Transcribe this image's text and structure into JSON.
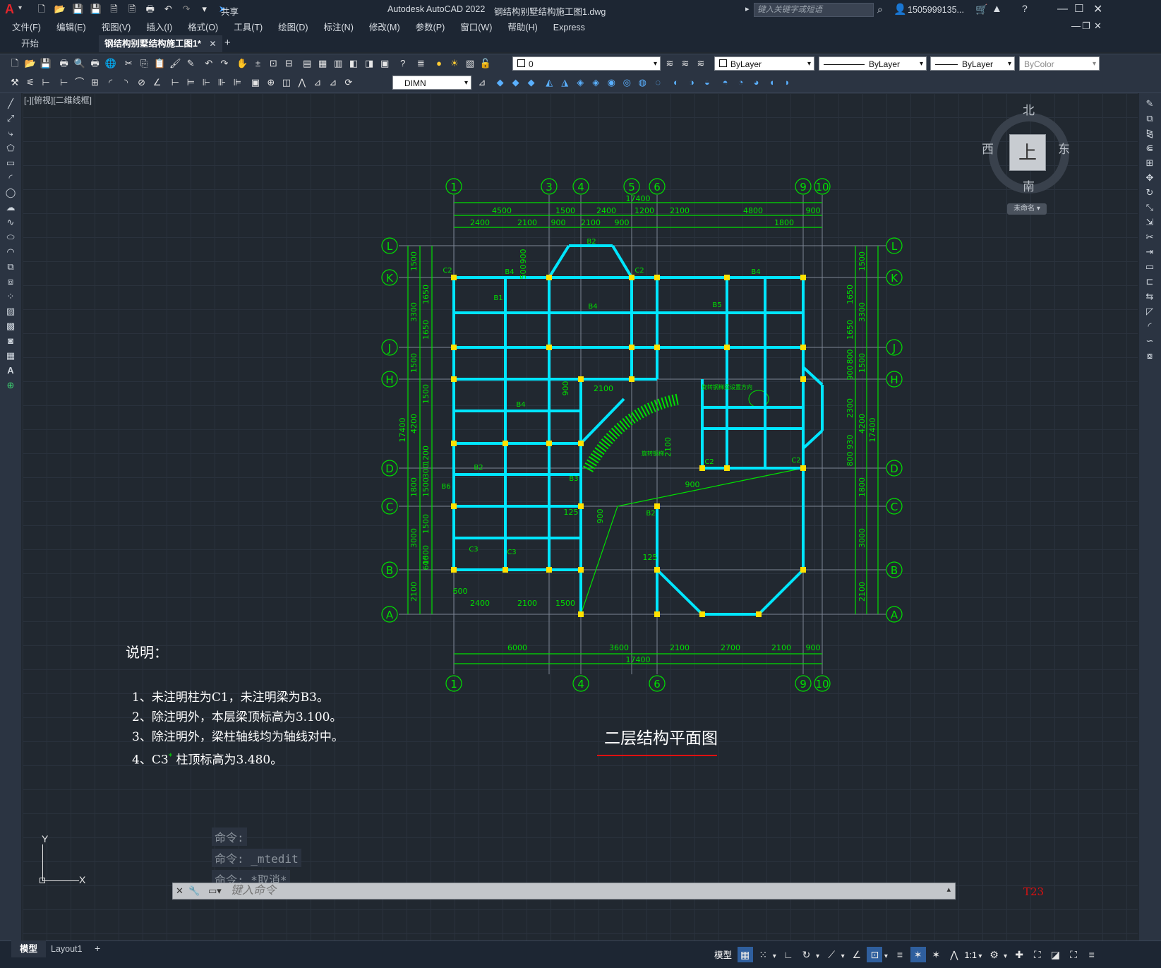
{
  "title_bar": {
    "app_letter": "A",
    "share_label": "共享",
    "app_title": "Autodesk AutoCAD 2022",
    "doc_title": "钢结构别墅结构施工图1.dwg",
    "search_placeholder": "键入关键字或短语",
    "user": "1505999135..."
  },
  "menu": [
    "文件(F)",
    "编辑(E)",
    "视图(V)",
    "插入(I)",
    "格式(O)",
    "工具(T)",
    "绘图(D)",
    "标注(N)",
    "修改(M)",
    "参数(P)",
    "窗口(W)",
    "帮助(H)",
    "Express"
  ],
  "tabs": {
    "start": "开始",
    "doc": "钢结构别墅结构施工图1*",
    "add": "+"
  },
  "toolbar": {
    "layer": "0",
    "color": "ByLayer",
    "linetype": "ByLayer",
    "lineweight": "ByLayer",
    "plotstyle": "ByColor",
    "dimstyle": "DIMN"
  },
  "viewport_label": "[-][俯视][二维线框]",
  "viewcube": {
    "north": "北",
    "south": "南",
    "east": "东",
    "west": "西",
    "face": "上",
    "wcs": "未命名"
  },
  "drawing": {
    "title": "二层结构平面图",
    "notes_heading": "说明：",
    "notes": [
      "1、未注明柱为C1，未注明梁为B3。",
      "2、除注明外，本层梁顶标高为3.100。",
      "3、除注明外，梁柱轴线均为轴线对中。",
      "4、C3",
      "柱顶标高为3.480。"
    ],
    "note4_mark": "*",
    "top_axes": [
      "1",
      "3",
      "4",
      "5",
      "6",
      "9",
      "10"
    ],
    "bottom_axes": [
      "1",
      "4",
      "6",
      "9",
      "10"
    ],
    "row_axes": [
      "L",
      "K",
      "J",
      "H",
      "D",
      "C",
      "B",
      "A"
    ],
    "top_total": "17400",
    "top_dims_1": [
      "4500",
      "1500",
      "2400",
      "1200",
      "2100",
      "4800",
      "900"
    ],
    "top_dims_2": [
      "2400",
      "2100",
      "900",
      "2100",
      "900",
      "1800"
    ],
    "bottom_dims": [
      "6000",
      "3600",
      "2100",
      "2700",
      "2100",
      "900"
    ],
    "bottom_total": "17400",
    "bottom_inner": [
      "600",
      "2400",
      "2100",
      "1500"
    ],
    "left_total": "17400",
    "left_dims": [
      "1500",
      "3300",
      "1500",
      "4200",
      "1800",
      "3000",
      "2100"
    ],
    "left_inner": [
      "1650",
      "1650",
      "1500",
      "1200",
      "300",
      "1500",
      "1500",
      "1500",
      "600"
    ],
    "right_total": "17400",
    "right_dims": [
      "1500",
      "3300",
      "1500",
      "4200",
      "1800",
      "3000",
      "2100"
    ],
    "right_inner": [
      "1650",
      "1650",
      "800",
      "900",
      "2300",
      "930",
      "800"
    ],
    "inner_dims": [
      "900",
      "500",
      "900",
      "2100",
      "2100",
      "900",
      "900",
      "125",
      "125"
    ],
    "stair_note_1": "旋转钢梯",
    "stair_note_2": "旋转钢梯梁设置方向",
    "beam_labels": [
      "B2",
      "B4",
      "B1",
      "B5",
      "B3",
      "B6",
      "B2",
      "B4",
      "B4",
      "B4",
      "B2"
    ],
    "col_labels": [
      "C2",
      "C3",
      "C2",
      "C2",
      "C3",
      "C2"
    ]
  },
  "ucs": {
    "y": "Y",
    "x": "X"
  },
  "command": {
    "history": [
      "命令:",
      "命令:  _mtedit",
      "命令: *取消*"
    ],
    "placeholder": "键入命令"
  },
  "status": {
    "tabs": [
      "模型",
      "Layout1",
      "+"
    ],
    "model_label": "模型",
    "scale": "1:1",
    "badge": "T23"
  },
  "colors": {
    "line": "#00e000",
    "beam": "#00e6ff",
    "column": "#ffe000",
    "axis": "#7d8694",
    "title_underline": "#e01010"
  }
}
